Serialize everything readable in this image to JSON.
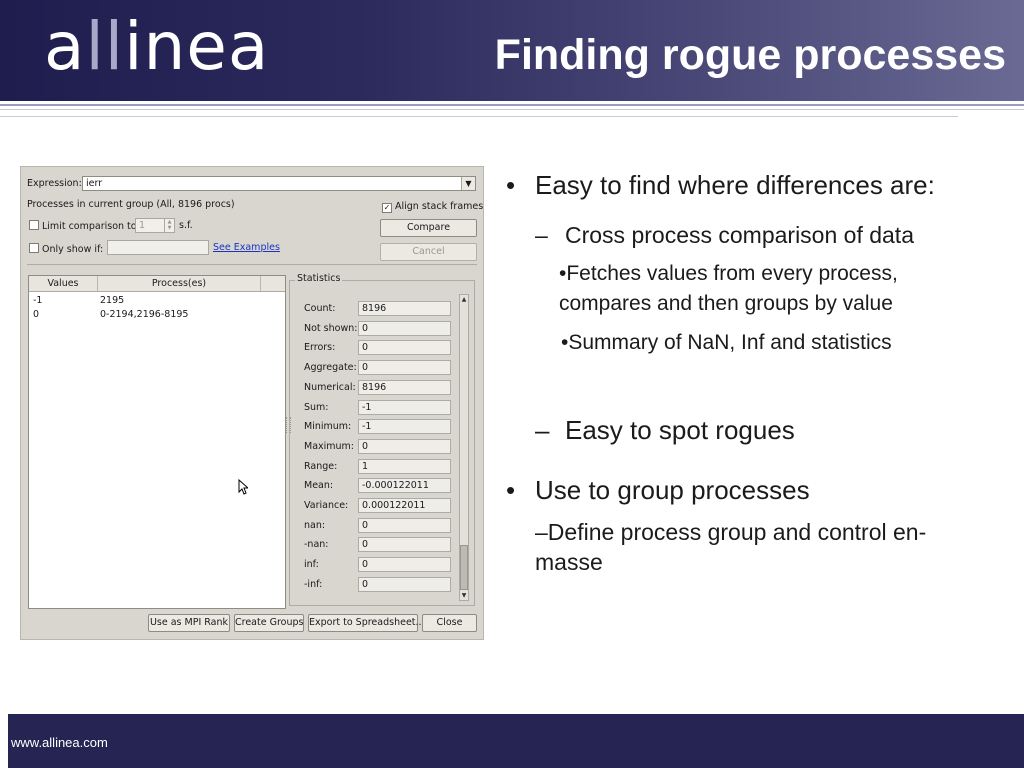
{
  "brand": {
    "logo_a": "a",
    "logo_ll": "ll",
    "logo_rest": "inea"
  },
  "slide": {
    "title": "Finding rogue processes"
  },
  "dialog": {
    "expression_label": "Expression:",
    "expression_value": "ierr",
    "processes_text": "Processes in current group (All, 8196 procs)",
    "align_stack_frames": "Align stack frames",
    "limit_comparison_label": "Limit comparison to",
    "limit_value": "1",
    "sf_label": "s.f.",
    "only_show_if_label": "Only show if:",
    "see_examples": "See Examples",
    "compare_button": "Compare",
    "cancel_button": "Cancel",
    "columns": [
      "Values",
      "Process(es)"
    ],
    "rows": [
      {
        "value": "-1",
        "processes": "2195"
      },
      {
        "value": "0",
        "processes": "0-2194,2196-8195"
      }
    ],
    "statistics_title": "Statistics",
    "statistics": [
      {
        "label": "Count:",
        "value": "8196"
      },
      {
        "label": "Not shown:",
        "value": "0"
      },
      {
        "label": "Errors:",
        "value": "0"
      },
      {
        "label": "Aggregate:",
        "value": "0"
      },
      {
        "label": "Numerical:",
        "value": "8196"
      },
      {
        "label": "Sum:",
        "value": "-1"
      },
      {
        "label": "Minimum:",
        "value": "-1"
      },
      {
        "label": "Maximum:",
        "value": "0"
      },
      {
        "label": "Range:",
        "value": "1"
      },
      {
        "label": "Mean:",
        "value": "-0.000122011"
      },
      {
        "label": "Variance:",
        "value": "0.000122011"
      },
      {
        "label": "nan:",
        "value": "0"
      },
      {
        "label": "-nan:",
        "value": "0"
      },
      {
        "label": "inf:",
        "value": "0"
      },
      {
        "label": "-inf:",
        "value": "0"
      }
    ],
    "buttons": {
      "use_as_mpi_rank": "Use as MPI Rank",
      "create_groups": "Create Groups",
      "export": "Export to Spreadsheet...",
      "close": "Close"
    }
  },
  "bullets": {
    "b1": "Easy to find where differences are:",
    "b1_sub": "Cross process comparison of data",
    "b1_sub_a_line1": "•Fetches values from every process,",
    "b1_sub_a_line2": "compares and then groups by value",
    "b1_sub_b": "•Summary of NaN, Inf and statistics",
    "b1_sub2": "Easy to spot rogues",
    "b2": "Use to group processes",
    "b2_sub_line1": "–Define process group and control en-",
    "b2_sub_line2": "masse",
    "bullet_char": "•",
    "dash_char": "–"
  },
  "footer": {
    "url": "www.allinea.com"
  },
  "colors": {
    "header_dark": "#1f1d4e",
    "footer": "#262452",
    "link": "#1a32c6"
  }
}
